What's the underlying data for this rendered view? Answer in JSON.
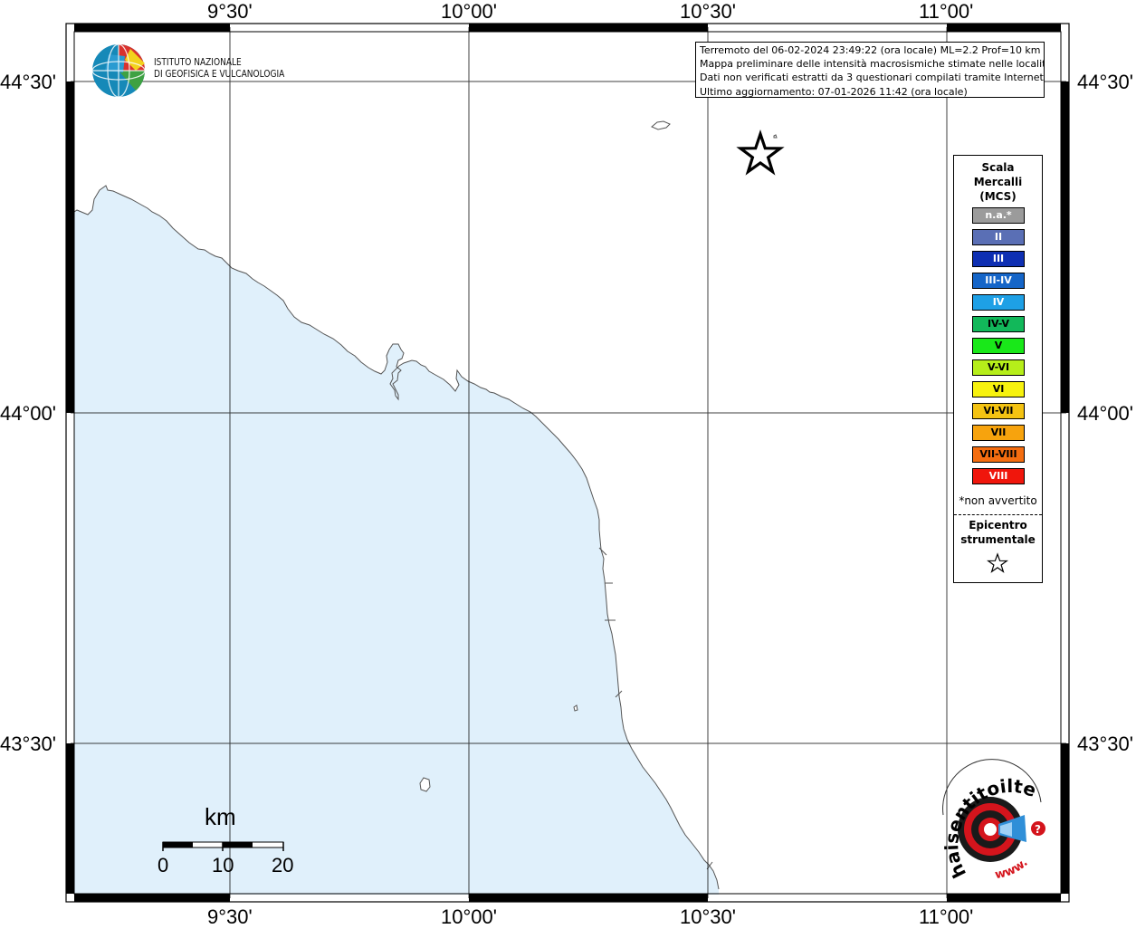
{
  "axes": {
    "top_labels": [
      "9°30'",
      "10°00'",
      "10°30'",
      "11°00'"
    ],
    "bottom_labels": [
      "9°30'",
      "10°00'",
      "10°30'",
      "11°00'"
    ],
    "left_labels": [
      "44°30'",
      "44°00'",
      "43°30'"
    ],
    "right_labels": [
      "44°30'",
      "44°00'",
      "43°30'"
    ]
  },
  "logo": {
    "line1": "ISTITUTO NAZIONALE",
    "line2": "DI GEOFISICA E VULCANOLOGIA"
  },
  "info": {
    "line1": "Terremoto del 06-02-2024 23:49:22 (ora locale) ML=2.2 Prof=10 km",
    "line2": "Mappa preliminare delle intensità macrosismiche stimate nelle località",
    "line3": "Dati non verificati estratti da 3 questionari compilati tramite Internet.",
    "line4": "Ultimo aggiornamento: 07-01-2026 11:42 (ora locale)"
  },
  "legend": {
    "title": "Scala\nMercalli\n(MCS)",
    "items": [
      {
        "label": "n.a.*",
        "color": "#9b9b9b",
        "text_color": "#ffffff"
      },
      {
        "label": "II",
        "color": "#5a6fb5",
        "text_color": "#ffffff"
      },
      {
        "label": "III",
        "color": "#0e2fb3",
        "text_color": "#ffffff"
      },
      {
        "label": "III-IV",
        "color": "#1565c8",
        "text_color": "#ffffff"
      },
      {
        "label": "IV",
        "color": "#1ea0e6",
        "text_color": "#ffffff"
      },
      {
        "label": "IV-V",
        "color": "#12b85a",
        "text_color": "#000000"
      },
      {
        "label": "V",
        "color": "#19e819",
        "text_color": "#000000"
      },
      {
        "label": "V-VI",
        "color": "#b6ee1a",
        "text_color": "#000000"
      },
      {
        "label": "VI",
        "color": "#f7f20e",
        "text_color": "#000000"
      },
      {
        "label": "VI-VII",
        "color": "#f4c312",
        "text_color": "#000000"
      },
      {
        "label": "VII",
        "color": "#f7a30d",
        "text_color": "#000000"
      },
      {
        "label": "VII-VIII",
        "color": "#f46d10",
        "text_color": "#000000"
      },
      {
        "label": "VIII",
        "color": "#f0160c",
        "text_color": "#ffffff"
      }
    ],
    "note": "*non avvertito",
    "epicenter_label": "Epicentro\nstrumentale"
  },
  "scale": {
    "unit": "km",
    "ticks": [
      "0",
      "10",
      "20"
    ]
  },
  "colors": {
    "sea": "#e0f0fb",
    "land": "#ffffff",
    "coast": "#555555",
    "grid": "#000000",
    "haisentito_red": "#d4141c"
  },
  "haisentito": {
    "text_a": "haisentitoilterremoto.it",
    "text_b": "www."
  }
}
